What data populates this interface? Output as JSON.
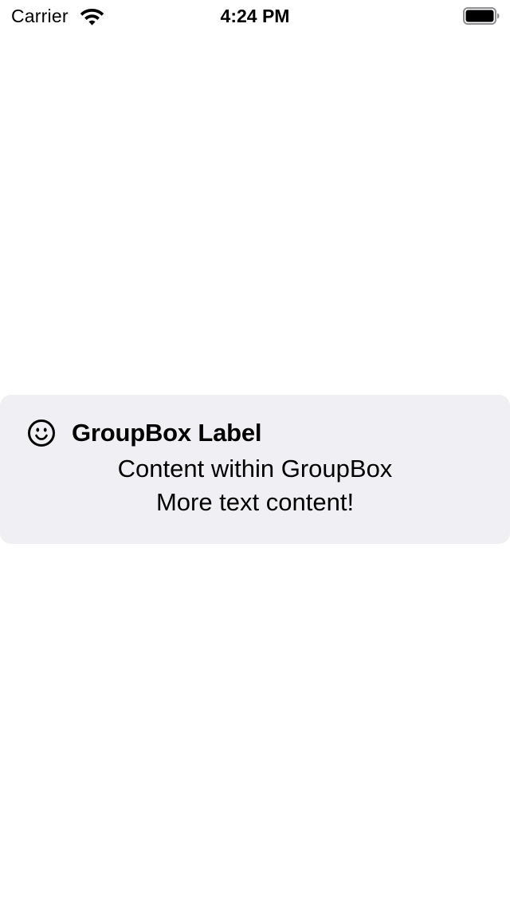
{
  "status_bar": {
    "carrier": "Carrier",
    "time": "4:24 PM",
    "wifi_icon": "wifi-icon",
    "battery_icon": "battery-full-icon"
  },
  "groupbox": {
    "icon": "smiley-face-icon",
    "label": "GroupBox Label",
    "content_lines": [
      "Content within GroupBox",
      "More text content!"
    ],
    "background_color": "#efeff4"
  }
}
